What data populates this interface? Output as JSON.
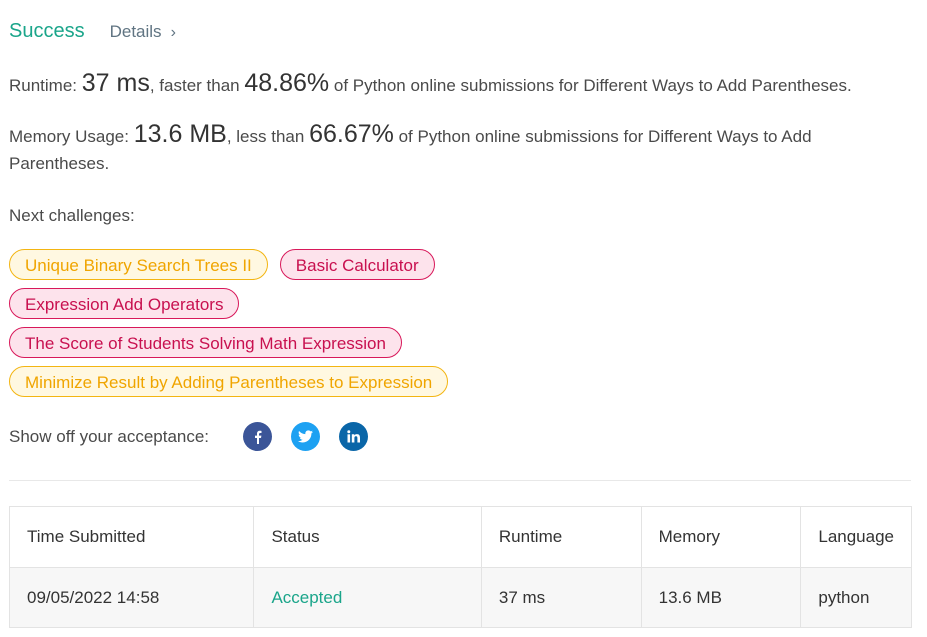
{
  "header": {
    "status": "Success",
    "details_label": "Details",
    "chevron": "›"
  },
  "runtime": {
    "label": "Runtime:",
    "value": "37 ms",
    "comparison": ", faster than",
    "percent": "48.86%",
    "suffix": "of Python online submissions for Different Ways to Add Parentheses."
  },
  "memory": {
    "label": "Memory Usage:",
    "value": "13.6 MB",
    "comparison": ", less than",
    "percent": "66.67%",
    "suffix": "of Python online submissions for Different Ways to Add Parentheses."
  },
  "next_challenges": {
    "label": "Next challenges:",
    "items": [
      {
        "title": "Unique Binary Search Trees II",
        "difficulty": "medium"
      },
      {
        "title": "Basic Calculator",
        "difficulty": "hard"
      },
      {
        "title": "Expression Add Operators",
        "difficulty": "hard"
      },
      {
        "title": "The Score of Students Solving Math Expression",
        "difficulty": "hard"
      },
      {
        "title": "Minimize Result by Adding Parentheses to Expression",
        "difficulty": "medium"
      }
    ]
  },
  "share": {
    "label": "Show off your acceptance:",
    "icons": [
      "facebook-icon",
      "twitter-icon",
      "linkedin-icon"
    ]
  },
  "submissions": {
    "headers": [
      "Time Submitted",
      "Status",
      "Runtime",
      "Memory",
      "Language"
    ],
    "rows": [
      {
        "time": "09/05/2022 14:58",
        "status": "Accepted",
        "runtime": "37 ms",
        "memory": "13.6 MB",
        "language": "python"
      }
    ]
  },
  "colors": {
    "success": "#1aa58a",
    "medium_text": "#f0a500",
    "medium_bg": "#fff8e1",
    "hard_text": "#c8104f",
    "hard_bg": "#fde3ec",
    "facebook": "#3b5598",
    "twitter": "#1da1f2",
    "linkedin": "#0a66a8"
  }
}
